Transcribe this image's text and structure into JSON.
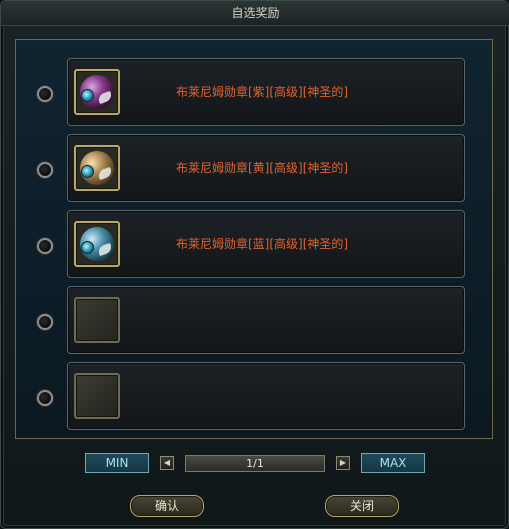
{
  "window": {
    "title": "自选奖励"
  },
  "items": [
    {
      "name": "布莱尼姆勋章[紫][高级][神圣的]",
      "icon": "purple-medal-icon",
      "color": "#e0632e"
    },
    {
      "name": "布莱尼姆勋章[黄][高级][神圣的]",
      "icon": "yellow-medal-icon",
      "color": "#e0632e"
    },
    {
      "name": "布莱尼姆勋章[蓝][高级][神圣的]",
      "icon": "blue-medal-icon",
      "color": "#e0632e"
    },
    {
      "name": "",
      "icon": "empty-slot"
    },
    {
      "name": "",
      "icon": "empty-slot"
    }
  ],
  "pager": {
    "min_label": "MIN",
    "max_label": "MAX",
    "page_value": "1/1",
    "prev_symbol": "◀",
    "next_symbol": "▶"
  },
  "buttons": {
    "confirm_label": "确认",
    "close_label": "关闭"
  }
}
